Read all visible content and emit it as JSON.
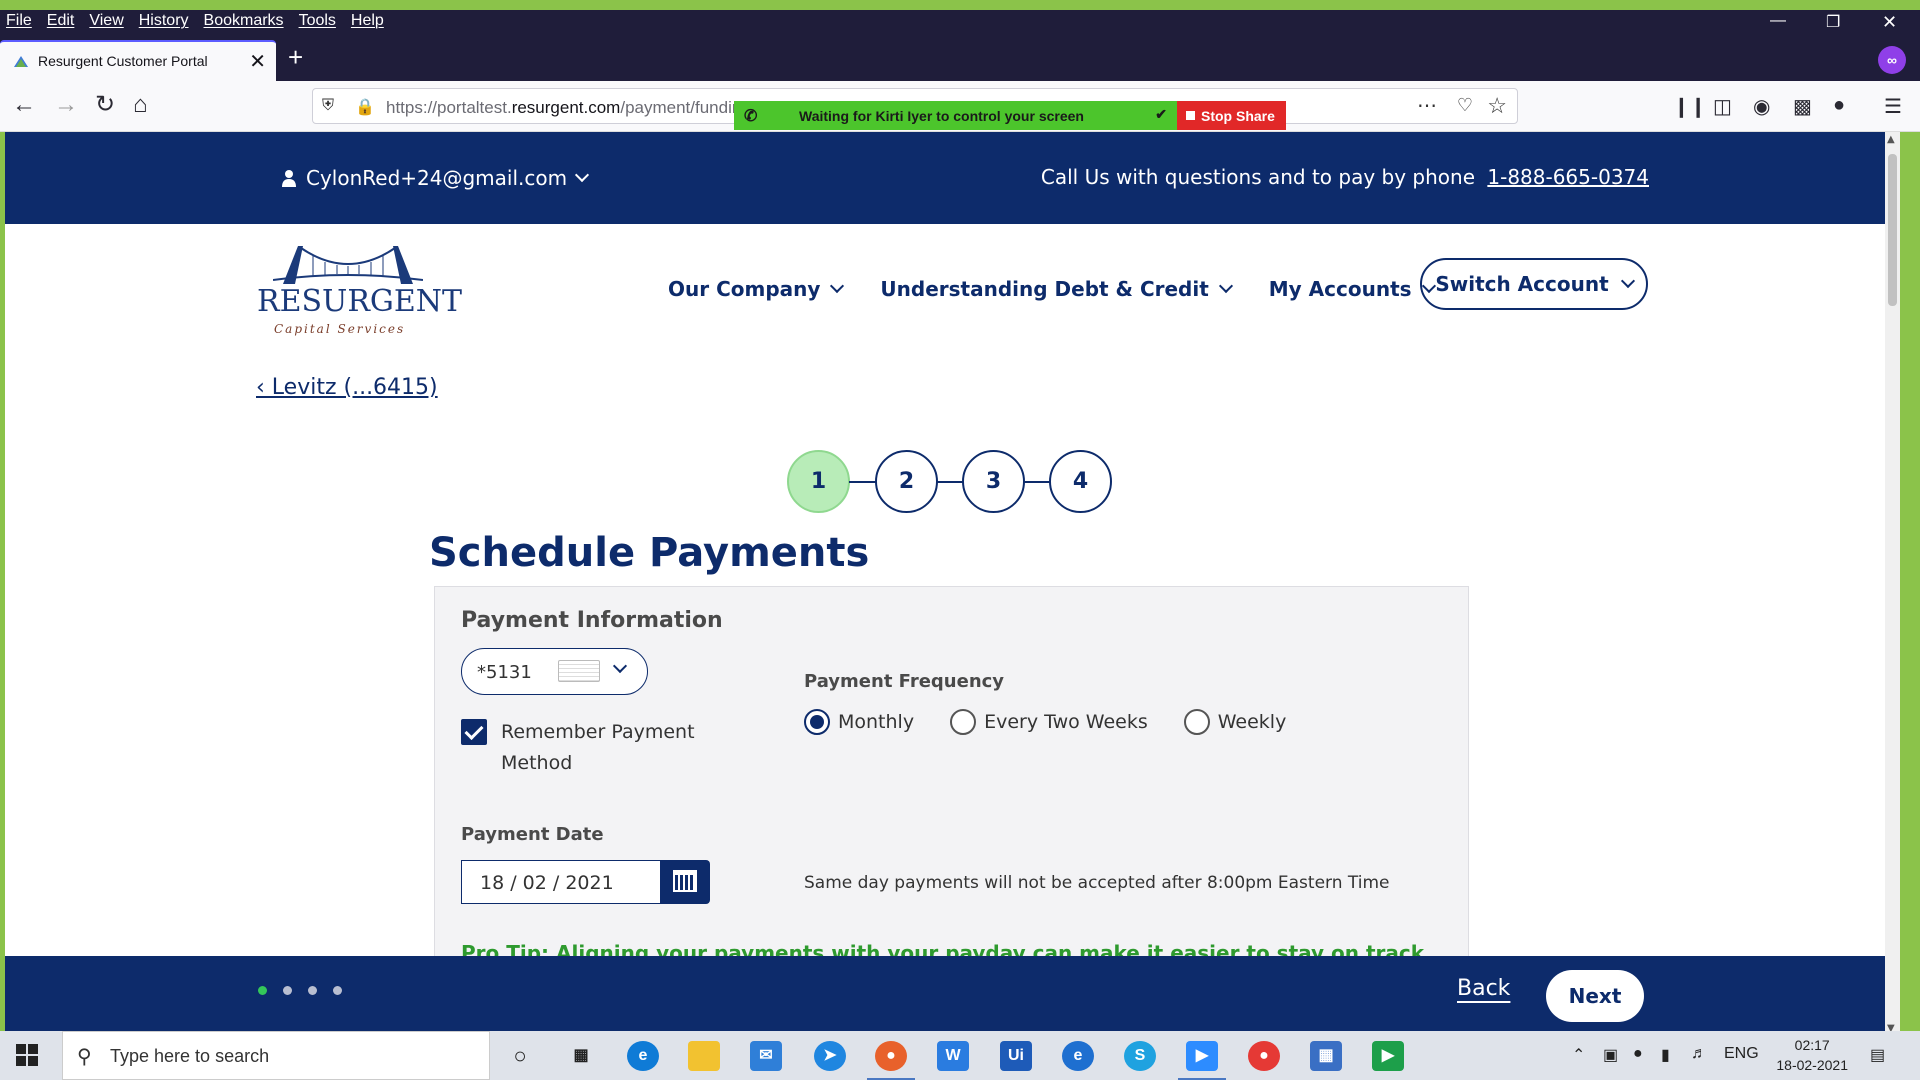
{
  "browser": {
    "menu": [
      "File",
      "Edit",
      "View",
      "History",
      "Bookmarks",
      "Tools",
      "Help"
    ],
    "tab_title": "Resurgent Customer Portal",
    "url_prefix": "https://portaltest.",
    "url_domain": "resurgent.com",
    "url_path": "/payment/funding",
    "share_banner": {
      "waiting_text": "Waiting for Kirti Iyer to control your screen",
      "stop_label": "Stop Share"
    }
  },
  "site": {
    "user_email": "CylonRed+24@gmail.com",
    "call_text": "Call Us with questions and to pay by phone",
    "phone": "1-888-665-0374",
    "logo_word": "RESURGENT",
    "logo_sub": "Capital Services",
    "nav": [
      "Our Company",
      "Understanding Debt & Credit",
      "My Accounts"
    ],
    "switch_account": "Switch Account",
    "back_link": "‹ Levitz (...6415)"
  },
  "stepper": {
    "steps": [
      "1",
      "2",
      "3",
      "4"
    ],
    "active": 1
  },
  "form": {
    "title": "Schedule Payments",
    "section_head": "Payment Information",
    "card_value": "*5131",
    "remember_label": "Remember Payment Method",
    "frequency_head": "Payment Frequency",
    "frequency_options": [
      "Monthly",
      "Every Two Weeks",
      "Weekly"
    ],
    "frequency_selected": "Monthly",
    "date_head": "Payment Date",
    "date_value": "18 / 02 / 2021",
    "note": "Same day payments will not be accepted after 8:00pm Eastern Time",
    "protip": "Pro Tip: Aligning your payments with your payday can make it easier to stay on track"
  },
  "footer": {
    "back": "Back",
    "next": "Next",
    "dots": 4,
    "active_dot": 1
  },
  "taskbar": {
    "search_placeholder": "Type here to search",
    "lang": "ENG",
    "time": "02:17",
    "date": "18-02-2021"
  },
  "colors": {
    "brand_navy": "#0d2b6b",
    "step_active": "#b8ecb8",
    "protip_green": "#2e9a2e",
    "share_green": "#4cc52c",
    "share_red": "#e12828"
  }
}
